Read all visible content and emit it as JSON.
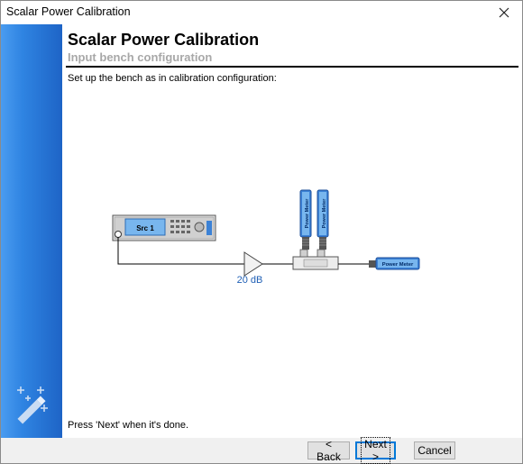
{
  "window": {
    "title": "Scalar Power Calibration",
    "close_icon": "close-icon"
  },
  "page": {
    "heading": "Scalar Power Calibration",
    "subheading": "Input bench configuration",
    "instruction": "Set up the bench as in calibration configuration:",
    "footer": "Press 'Next' when it's done."
  },
  "diagram": {
    "source_label": "Src 1",
    "amplifier_gain": "20 dB",
    "power_meter_label": "Power Meter",
    "power_meter_top_left": "Power Meter",
    "power_meter_top_right": "Power Meter"
  },
  "buttons": {
    "back": "< Back",
    "next": "Next >",
    "cancel": "Cancel"
  },
  "colors": {
    "sidebar": "#2f84e2",
    "meter_blue": "#3c82d6",
    "gain_text": "#1f5fb5"
  }
}
